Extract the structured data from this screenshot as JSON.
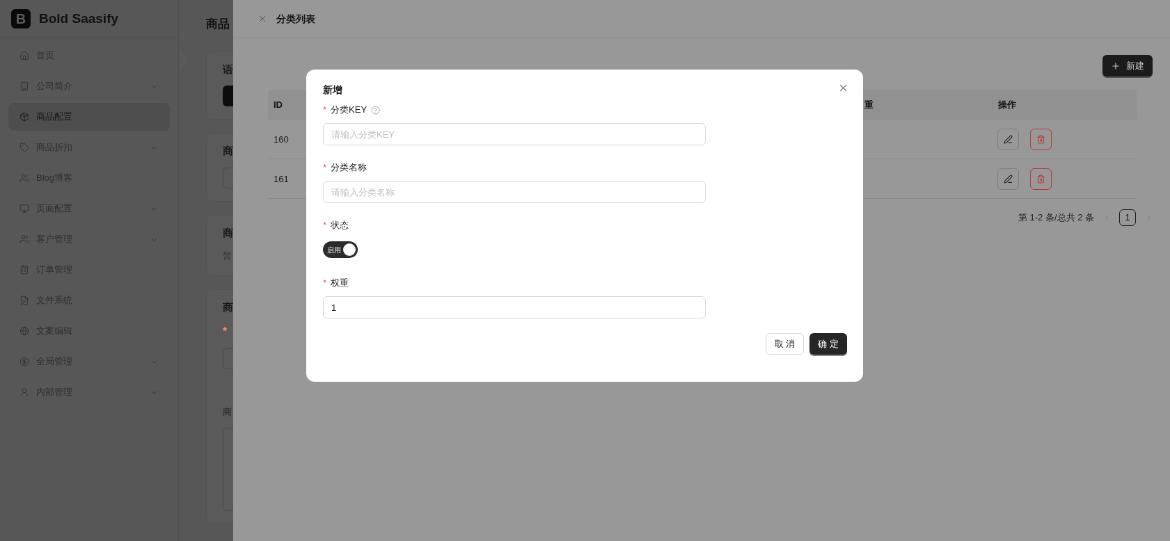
{
  "app": {
    "logo_letter": "B",
    "brand": "Bold Saasify"
  },
  "sidebar": {
    "items": [
      {
        "label": "首页",
        "has_submenu": false,
        "selected": false
      },
      {
        "label": "公司简介",
        "has_submenu": true,
        "selected": false
      },
      {
        "label": "商品配置",
        "has_submenu": false,
        "selected": true
      },
      {
        "label": "商品折扣",
        "has_submenu": true,
        "selected": false
      },
      {
        "label": "Blog博客",
        "has_submenu": false,
        "selected": false
      },
      {
        "label": "页面配置",
        "has_submenu": true,
        "selected": false
      },
      {
        "label": "客户管理",
        "has_submenu": true,
        "selected": false
      },
      {
        "label": "订单管理",
        "has_submenu": false,
        "selected": false
      },
      {
        "label": "文件系统",
        "has_submenu": false,
        "selected": false
      },
      {
        "label": "文案编辑",
        "has_submenu": false,
        "selected": false
      },
      {
        "label": "全局管理",
        "has_submenu": true,
        "selected": false
      },
      {
        "label": "内部管理",
        "has_submenu": true,
        "selected": false
      }
    ]
  },
  "background_page": {
    "title": "商品",
    "cards": [
      {
        "kind": "button",
        "title": "语"
      },
      {
        "kind": "input",
        "title": "商"
      },
      {
        "kind": "text",
        "title": "商",
        "text": "暂"
      },
      {
        "kind": "form",
        "title": "商",
        "required_mark": "*",
        "label": "商"
      }
    ]
  },
  "drawer": {
    "title": "分类列表",
    "new_button": "新建",
    "table": {
      "columns": [
        "ID",
        "重",
        "操作"
      ],
      "rows": [
        {
          "id": "160"
        },
        {
          "id": "161"
        }
      ]
    },
    "pagination": {
      "summary": "第 1-2 条/总共 2 条",
      "pages": [
        {
          "label": "1",
          "selected": true
        }
      ]
    }
  },
  "modal": {
    "title": "新增",
    "fields": [
      {
        "kind": "text",
        "required_mark": "*",
        "label": "分类KEY",
        "help": true,
        "placeholder": "请输入分类KEY"
      },
      {
        "kind": "text",
        "required_mark": "*",
        "label": "分类名称",
        "help": false,
        "placeholder": "请输入分类名称"
      },
      {
        "kind": "switch",
        "required_mark": "*",
        "label": "状态",
        "help": false,
        "on": true,
        "on_text": "启用"
      },
      {
        "kind": "text",
        "required_mark": "*",
        "label": "权重",
        "help": false,
        "value": "1"
      }
    ],
    "buttons": [
      {
        "kind": "default",
        "label": "取 消"
      },
      {
        "kind": "primary",
        "label": "确 定"
      }
    ]
  }
}
